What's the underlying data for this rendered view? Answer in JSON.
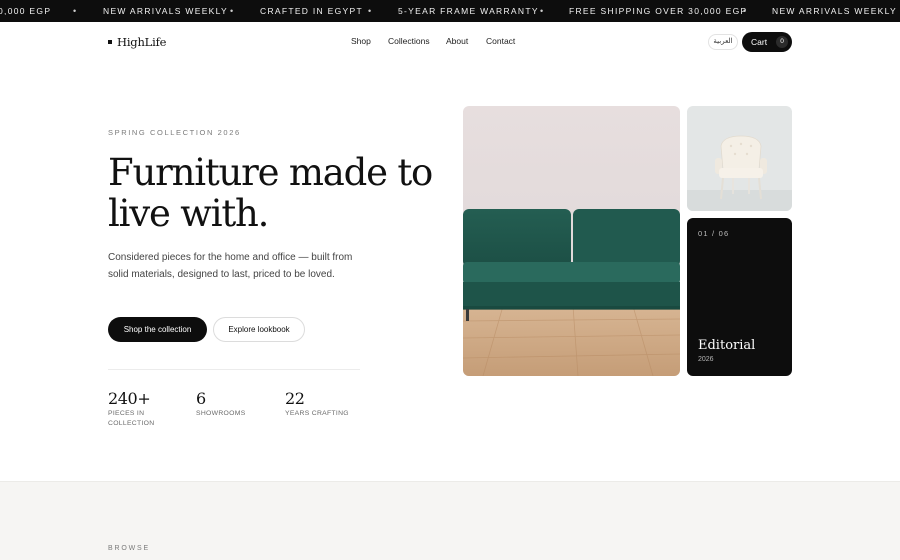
{
  "ticker": {
    "items": [
      "0,000 EGP",
      "NEW ARRIVALS WEEKLY",
      "CRAFTED IN EGYPT",
      "5-YEAR FRAME WARRANTY",
      "FREE SHIPPING OVER 30,000 EGP",
      "NEW ARRIVALS WEEKLY"
    ],
    "separator": "•"
  },
  "nav": {
    "logo": "HighLife",
    "links": [
      "Shop",
      "Collections",
      "About",
      "Contact"
    ],
    "language": "العربية",
    "cart_label": "Cart",
    "cart_count": "0"
  },
  "hero": {
    "eyebrow": "SPRING COLLECTION 2026",
    "title": "Furniture made to live with.",
    "description": "Considered pieces for the home and office — built from solid materials, designed to last, priced to be loved.",
    "primary_cta": "Shop the collection",
    "secondary_cta": "Explore lookbook",
    "stats": [
      {
        "value": "240+",
        "label": "PIECES IN COLLECTION"
      },
      {
        "value": "6",
        "label": "SHOWROOMS"
      },
      {
        "value": "22",
        "label": "YEARS CRAFTING"
      }
    ]
  },
  "gallery": {
    "editorial_count": "01 / 06",
    "editorial_title": "Editorial",
    "editorial_year": "2026"
  },
  "browse": {
    "label": "BROWSE"
  },
  "colors": {
    "ticker_bg": "#0d0d0d",
    "primary_button": "#0d0d0d",
    "sofa_green": "#1f5a4f",
    "floor_wood": "#c9a27d",
    "section_bg": "#f6f5f3"
  },
  "icons": {
    "logo_mark": "square-dot-icon"
  }
}
